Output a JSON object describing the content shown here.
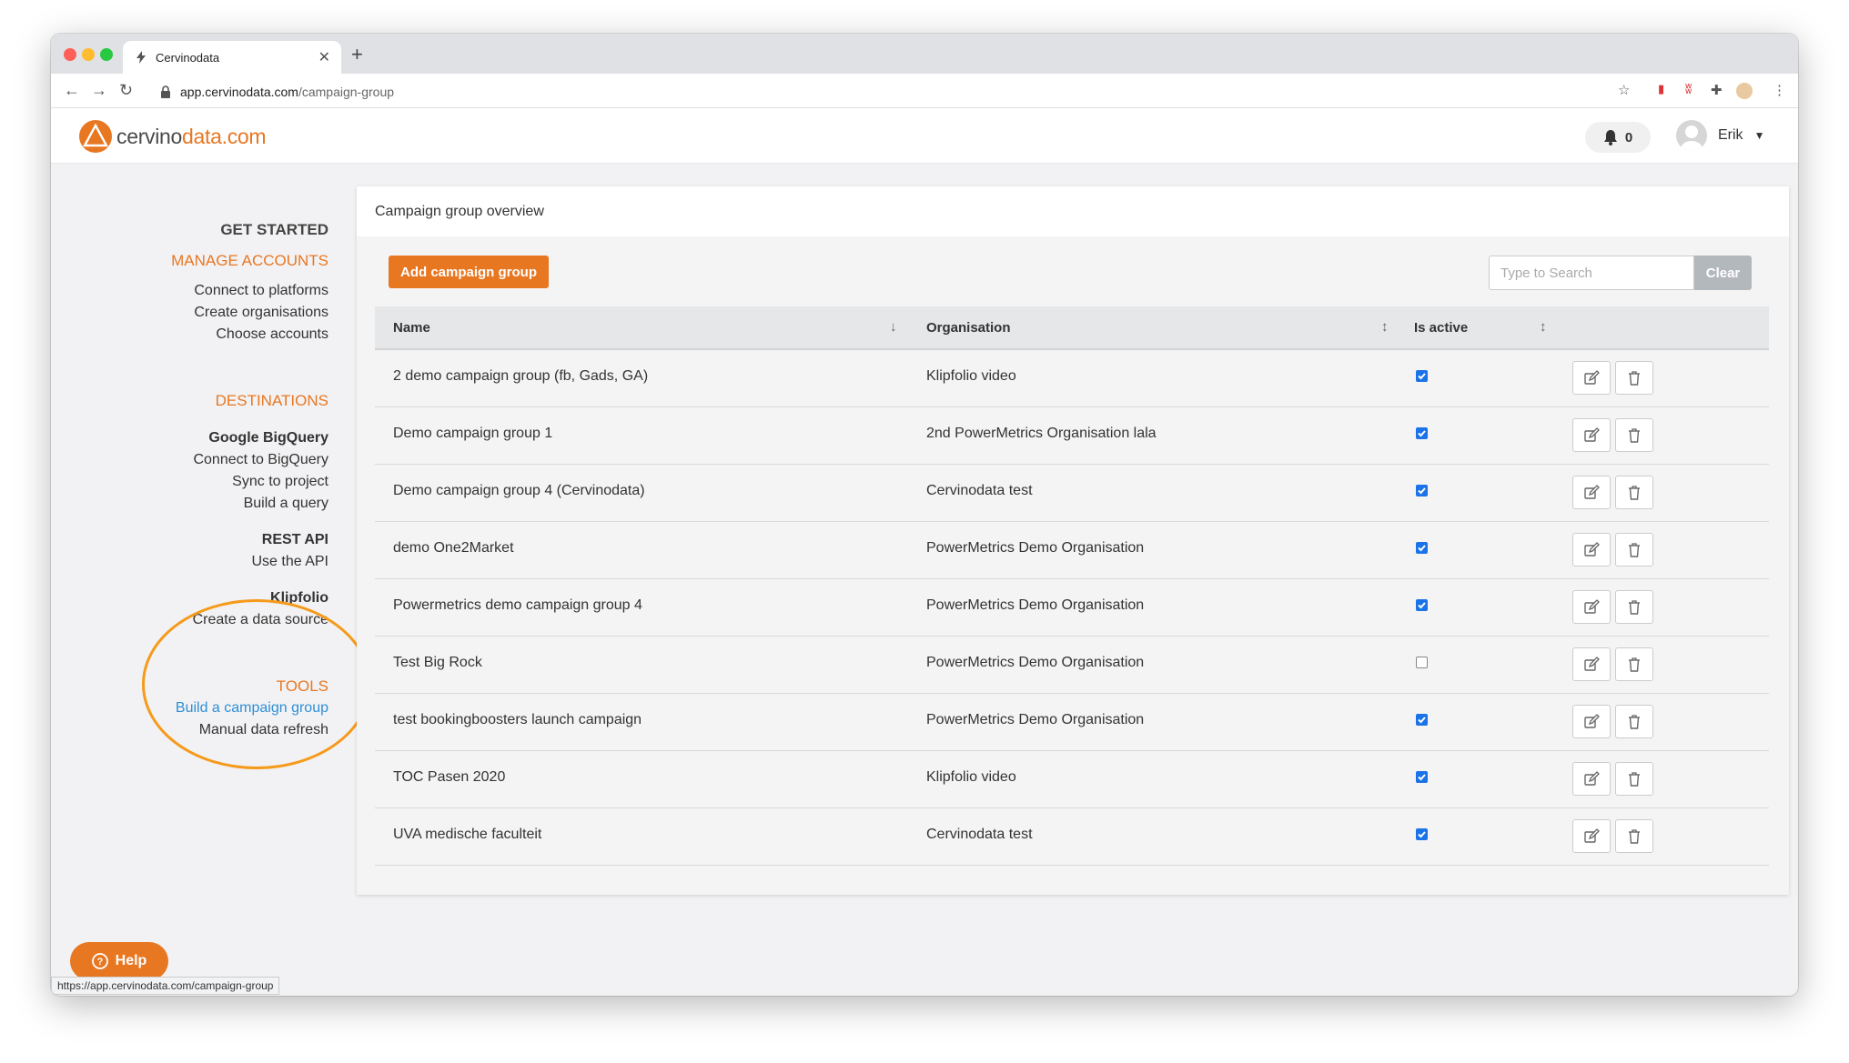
{
  "browser": {
    "tab_title": "Cervinodata",
    "url_host": "app.cervinodata.com",
    "url_path": "/campaign-group",
    "status_url": "https://app.cervinodata.com/campaign-group"
  },
  "header": {
    "logo_cervino": "cervino",
    "logo_data": "data.com",
    "notification_count": "0",
    "user_name": "Erik"
  },
  "sidebar": {
    "get_started": "GET STARTED",
    "manage_accounts": "MANAGE ACCOUNTS",
    "connect_platforms": "Connect to platforms",
    "create_organisations": "Create organisations",
    "choose_accounts": "Choose accounts",
    "destinations": "DESTINATIONS",
    "google_bigquery": "Google BigQuery",
    "connect_bigquery": "Connect to BigQuery",
    "sync_project": "Sync to project",
    "build_query": "Build a query",
    "rest_api": "REST API",
    "use_api": "Use the API",
    "klipfolio": "Klipfolio",
    "create_data_source": "Create a data source",
    "tools": "TOOLS",
    "build_campaign_group": "Build a campaign group",
    "manual_refresh": "Manual data refresh"
  },
  "main": {
    "title": "Campaign group overview",
    "add_button": "Add campaign group",
    "search_placeholder": "Type to Search",
    "clear_button": "Clear",
    "columns": {
      "name": "Name",
      "organisation": "Organisation",
      "is_active": "Is active"
    },
    "rows": [
      {
        "name": "2 demo campaign group (fb, Gads, GA)",
        "organisation": "Klipfolio video",
        "active": true
      },
      {
        "name": "Demo campaign group 1",
        "organisation": "2nd PowerMetrics Organisation lala",
        "active": true
      },
      {
        "name": "Demo campaign group 4 (Cervinodata)",
        "organisation": "Cervinodata test",
        "active": true
      },
      {
        "name": "demo One2Market",
        "organisation": "PowerMetrics Demo Organisation",
        "active": true
      },
      {
        "name": "Powermetrics demo campaign group 4",
        "organisation": "PowerMetrics Demo Organisation",
        "active": true
      },
      {
        "name": "Test Big Rock",
        "organisation": "PowerMetrics Demo Organisation",
        "active": false
      },
      {
        "name": "test bookingboosters launch campaign",
        "organisation": "PowerMetrics Demo Organisation",
        "active": true
      },
      {
        "name": "TOC Pasen 2020",
        "organisation": "Klipfolio video",
        "active": true
      },
      {
        "name": "UVA medische faculteit",
        "organisation": "Cervinodata test",
        "active": true
      }
    ]
  },
  "help": {
    "label": "Help"
  },
  "colors": {
    "brand_orange": "#e87722",
    "link_blue": "#2e8fd6",
    "checkbox_blue": "#1a73e8",
    "highlight_circle": "#f59a1b"
  }
}
